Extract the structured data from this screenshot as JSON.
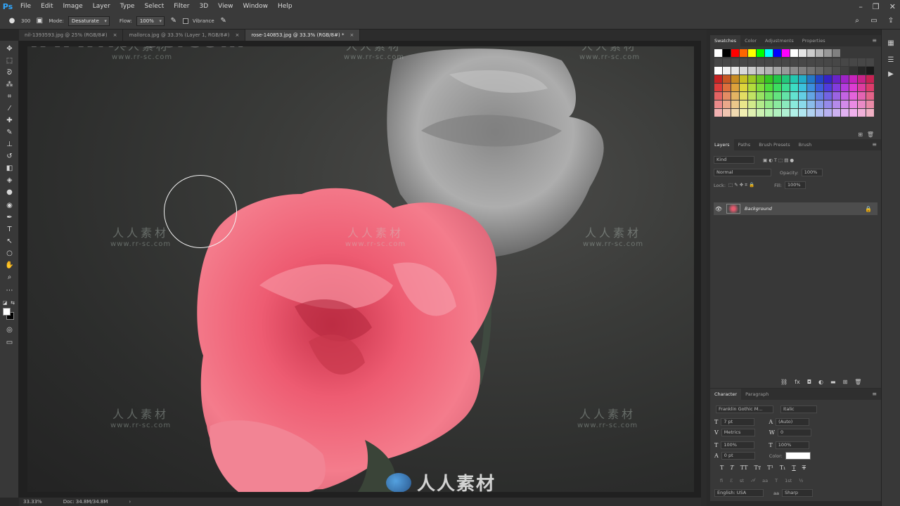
{
  "app": {
    "logo": "Ps"
  },
  "menu": [
    "File",
    "Edit",
    "Image",
    "Layer",
    "Type",
    "Select",
    "Filter",
    "3D",
    "View",
    "Window",
    "Help"
  ],
  "options": {
    "size_value": "300",
    "mode_label": "Mode:",
    "mode_value": "Desaturate",
    "flow_label": "Flow:",
    "flow_value": "100%",
    "vibrance_label": "Vibrance"
  },
  "tabs": [
    {
      "label": "nil-1393593.jpg @ 25% (RGB/8#)",
      "close": "×"
    },
    {
      "label": "mallorca.jpg @ 33.3% (Layer 1, RGB/8#)",
      "close": "×"
    },
    {
      "label": "rose-140853.jpg @ 33.3% (RGB/8#) *",
      "close": "×"
    }
  ],
  "status": {
    "zoom": "33.33%",
    "doc": "Doc: 34.8M/34.8M",
    "arrow": "›"
  },
  "watermark": {
    "cn": "人人素材",
    "url": "www.rr-sc.com",
    "big_url": "www.rr-sc.com",
    "logo_text": "人人素材"
  },
  "swatches_panel": {
    "tabs": [
      "Swatches",
      "Color",
      "Adjustments",
      "Properties"
    ],
    "colors": [
      "#ffffff",
      "#000000",
      "#ff0000",
      "#ff6600",
      "#ffff00",
      "#00ff00",
      "#00ffff",
      "#0000ff",
      "#ff00ff",
      "#ffffff",
      "#e6e6e6",
      "#cccccc",
      "#b3b3b3",
      "#999999",
      "#808080",
      "#666666",
      "#4d4d4d",
      "#333333",
      "#1a1a1a"
    ]
  },
  "layers_panel": {
    "tabs": [
      "Layers",
      "Paths",
      "Brush Presets",
      "Brush"
    ],
    "kind_placeholder": "Kind",
    "blend_mode": "Normal",
    "opacity_label": "Opacity:",
    "opacity_value": "100%",
    "lock_label": "Lock:",
    "fill_label": "Fill:",
    "fill_value": "100%",
    "layer_name": "Background"
  },
  "character_panel": {
    "tabs": [
      "Character",
      "Paragraph"
    ],
    "font_family": "Franklin Gothic M...",
    "font_style": "Italic",
    "size": "7 pt",
    "leading": "(Auto)",
    "kerning": "Metrics",
    "tracking": "0",
    "vscale": "100%",
    "hscale": "100%",
    "baseline": "0 pt",
    "color_label": "Color:",
    "language": "English: USA",
    "antialias": "Sharp"
  }
}
